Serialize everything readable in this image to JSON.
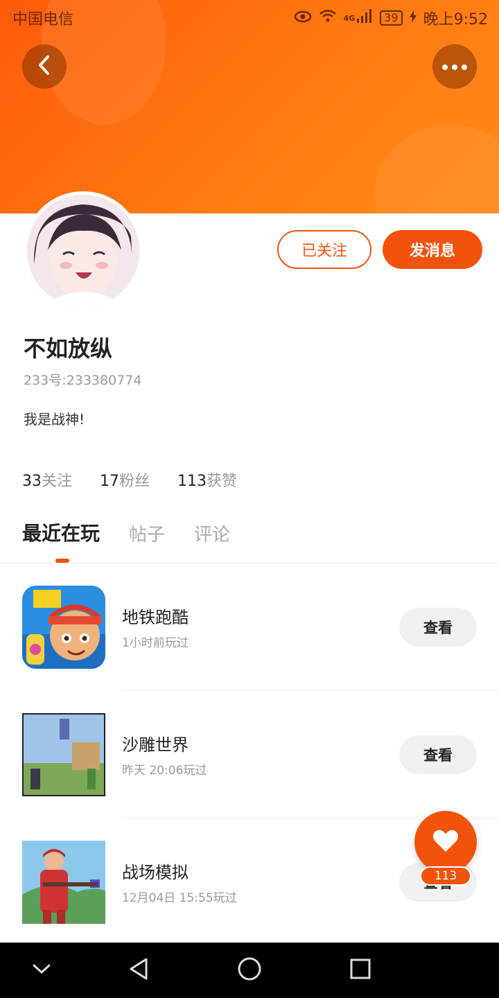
{
  "status_bar": {
    "carrier": "中国电信",
    "network": "4G",
    "battery": "39",
    "time": "晚上9:52"
  },
  "header": {
    "back_icon": "chevron-left-icon",
    "more_icon": "more-dots-icon"
  },
  "profile": {
    "follow_button": "已关注",
    "message_button": "发消息",
    "name": "不如放纵",
    "id_text": "233号:233380774",
    "bio": "我是战神!"
  },
  "stats": [
    {
      "value": "33",
      "label": "关注"
    },
    {
      "value": "17",
      "label": "粉丝"
    },
    {
      "value": "113",
      "label": "获赞"
    }
  ],
  "tabs": [
    {
      "label": "最近在玩",
      "active": true
    },
    {
      "label": "帖子",
      "active": false
    },
    {
      "label": "评论",
      "active": false
    }
  ],
  "games": [
    {
      "name": "地铁跑酷",
      "time": "1小时前玩过",
      "button": "查看"
    },
    {
      "name": "沙雕世界",
      "time": "昨天 20:06玩过",
      "button": "查看"
    },
    {
      "name": "战场模拟",
      "time": "12月04日 15:55玩过",
      "button": "查看"
    }
  ],
  "like": {
    "count": "113",
    "icon": "heart-icon"
  },
  "colors": {
    "accent": "#f2530c",
    "banner_start": "#ff5a0a",
    "banner_end": "#ff8a1a"
  }
}
